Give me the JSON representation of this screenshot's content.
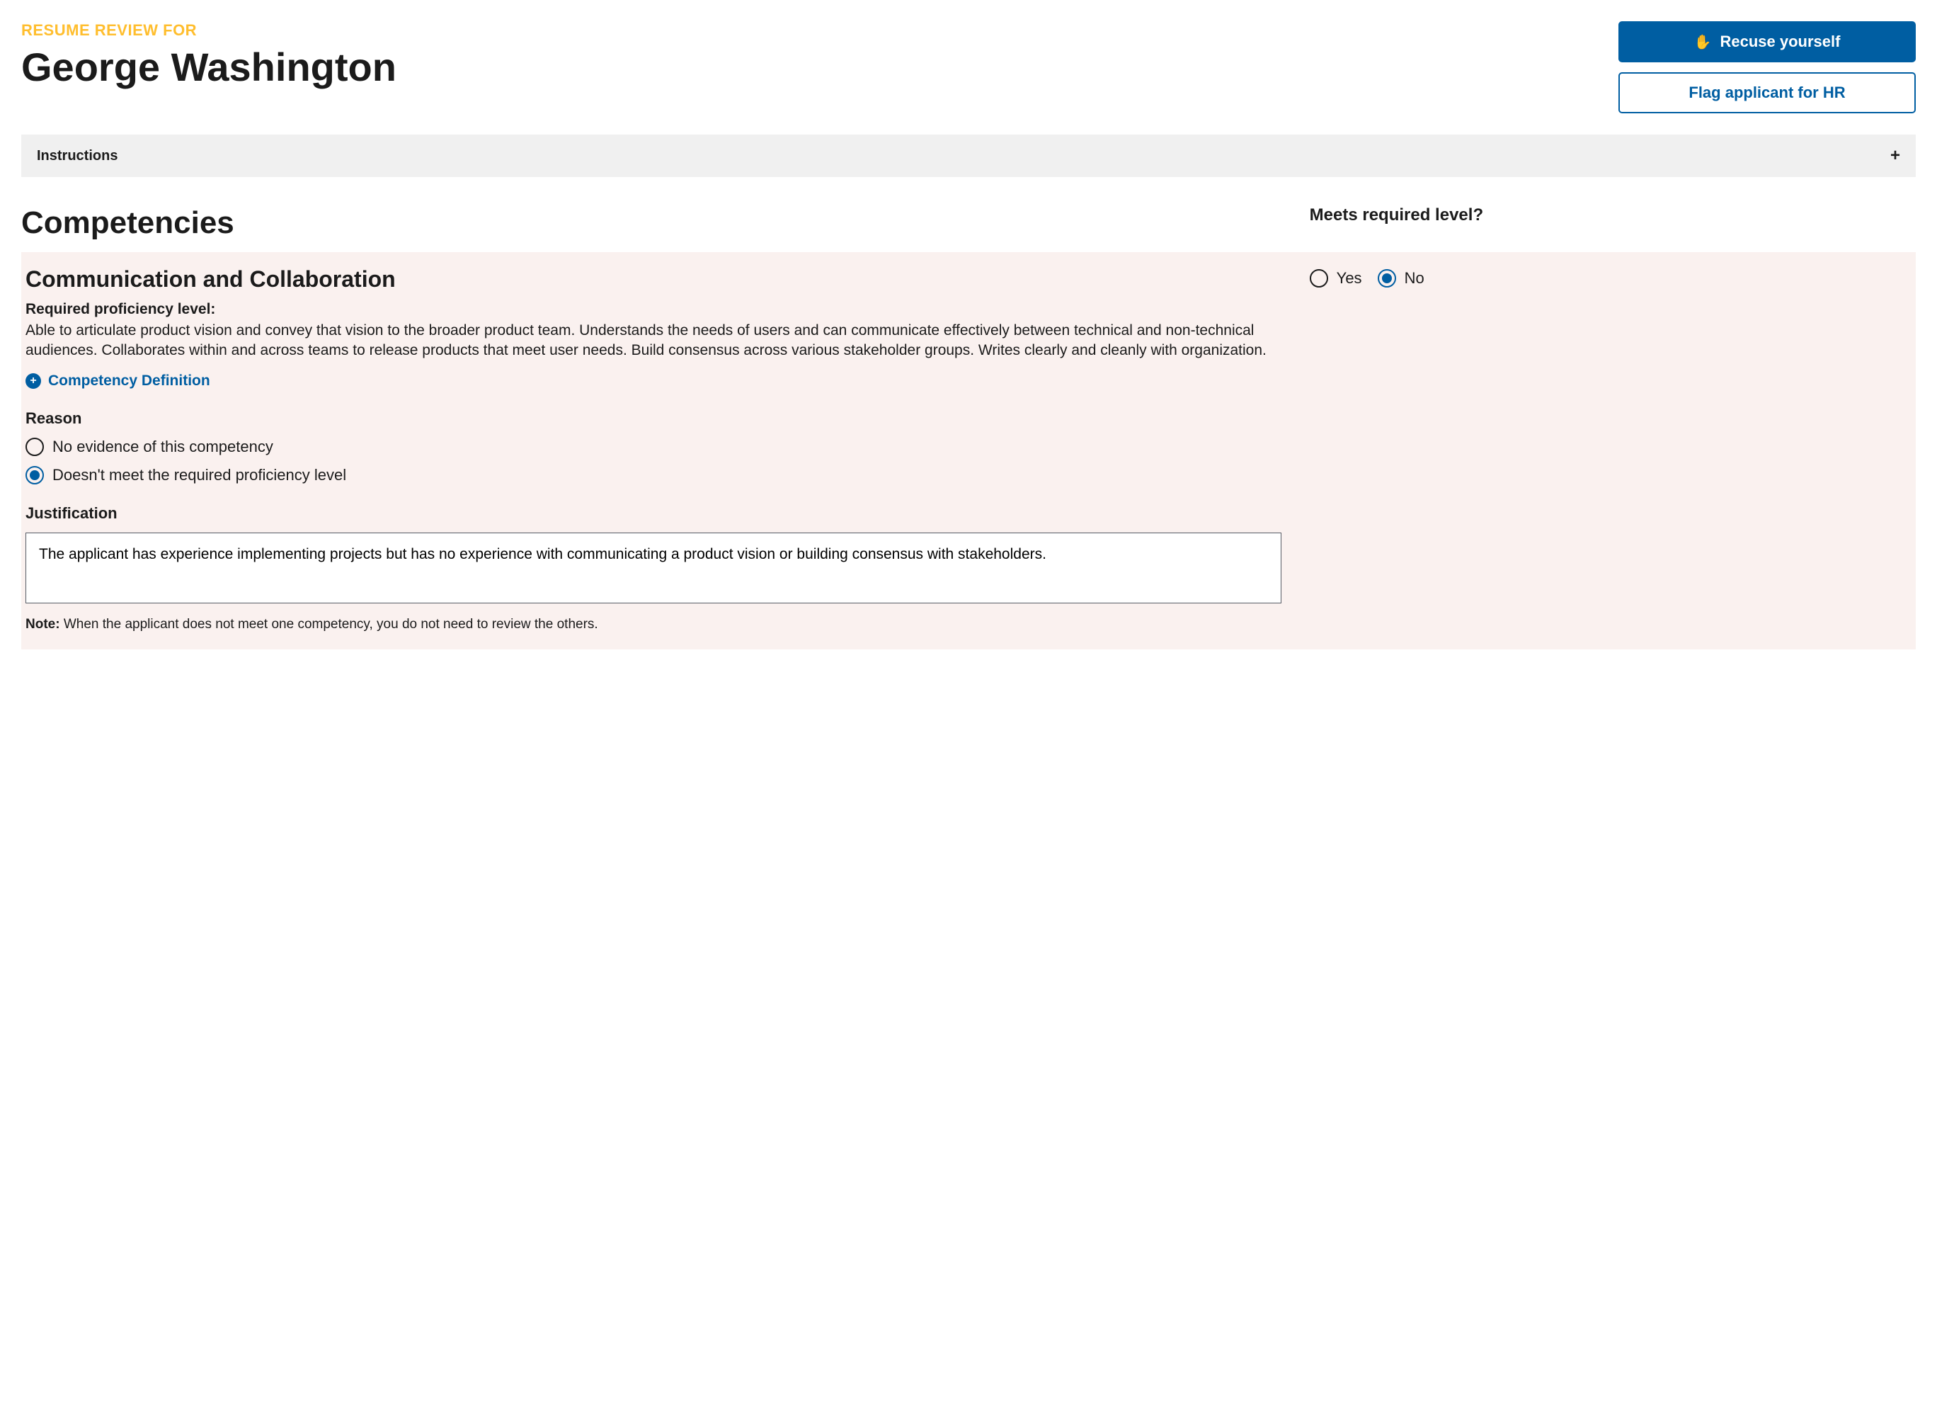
{
  "header": {
    "eyebrow": "RESUME REVIEW FOR",
    "applicant_name": "George Washington",
    "recuse_label": "Recuse yourself",
    "flag_label": "Flag applicant for HR"
  },
  "instructions": {
    "label": "Instructions"
  },
  "section": {
    "title": "Competencies",
    "meets_label": "Meets required level?"
  },
  "meets": {
    "yes_label": "Yes",
    "no_label": "No",
    "selected": "no"
  },
  "competency": {
    "title": "Communication and Collaboration",
    "req_label": "Required proficiency level:",
    "req_text": "Able to articulate product vision and convey that vision to the broader product team. Understands the needs of users and can communicate effectively between technical and non-technical audiences.  Collaborates within and across teams to release products that meet user needs.  Build consensus across various stakeholder groups. Writes clearly and cleanly with organization.",
    "def_label": "Competency Definition"
  },
  "reason": {
    "title": "Reason",
    "opt1": "No evidence of this competency",
    "opt2": "Doesn't meet the required proficiency level",
    "selected": "opt2"
  },
  "justification": {
    "title": "Justification",
    "text": "The applicant has experience implementing projects but has no experience with communicating a product vision or building consensus with stakeholders."
  },
  "note": {
    "label": "Note:",
    "text": " When the applicant does not meet one competency, you do not need to review the others."
  }
}
